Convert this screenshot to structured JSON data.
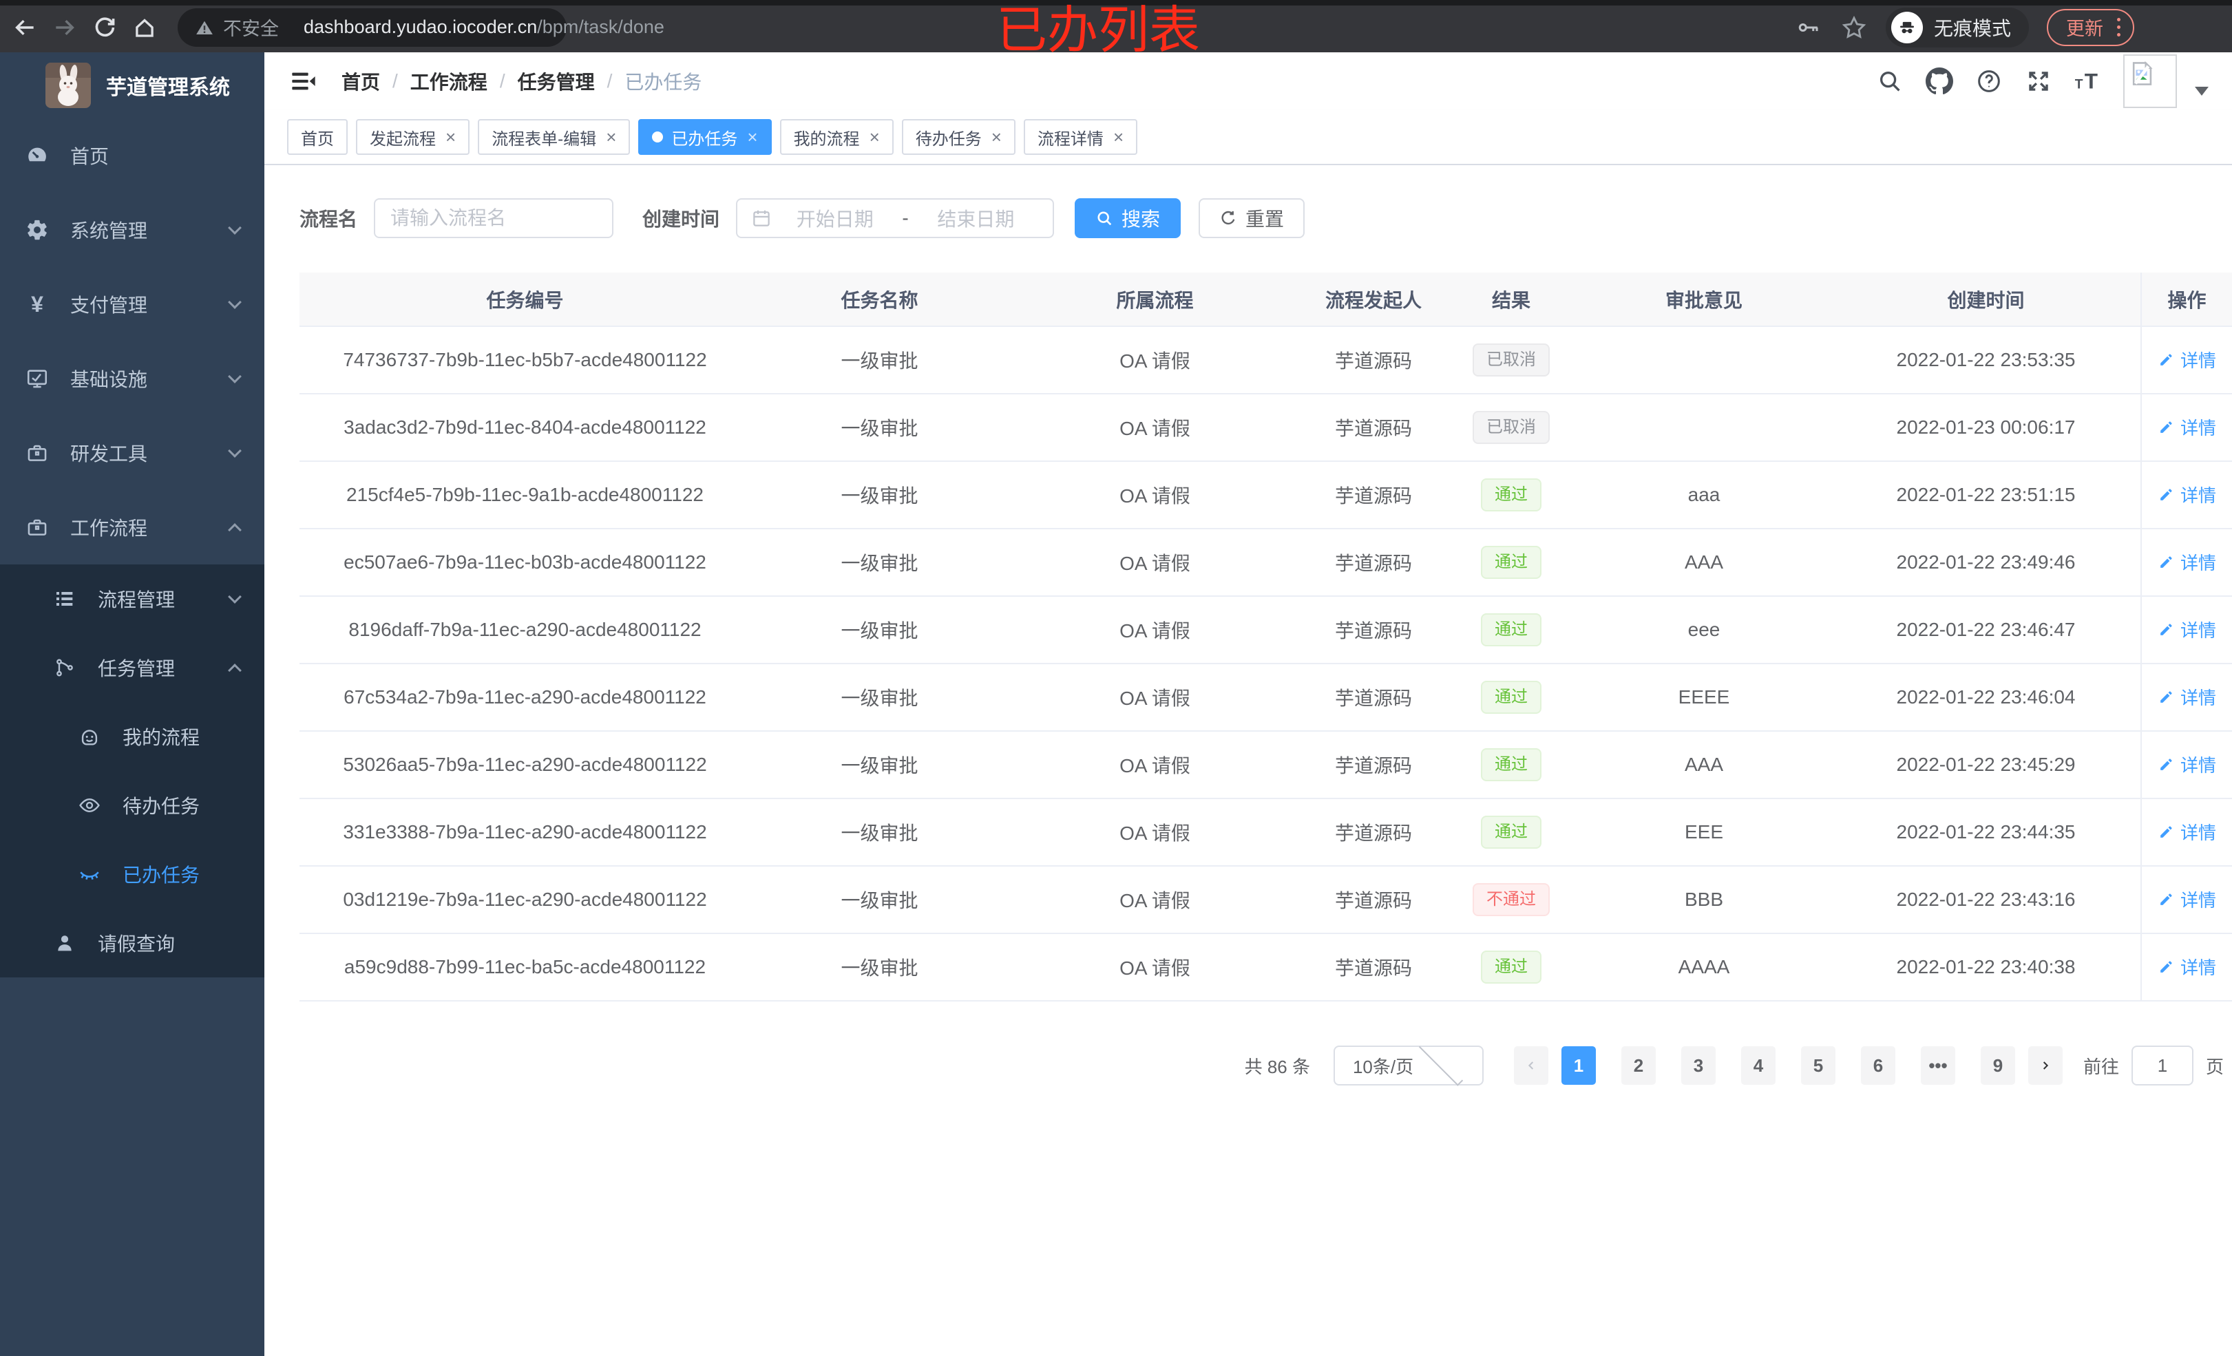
{
  "colors": {
    "accent": "#409eff",
    "success": "#67c23a",
    "danger": "#f56c6c",
    "info": "#909399",
    "sidebar_bg": "#304156",
    "submenu_bg": "#1f2d3d",
    "annotation_red": "#fe2c19",
    "update_chip": "#f28b82"
  },
  "annotation": {
    "text": "已办列表"
  },
  "browser": {
    "security_label": "不安全",
    "url_host": "dashboard.yudao.iocoder.cn",
    "url_path": "/bpm/task/done",
    "incognito_label": "无痕模式",
    "update_label": "更新"
  },
  "sidebar": {
    "title": "芋道管理系统",
    "items": [
      {
        "label": "首页",
        "icon": "dashboard-icon"
      },
      {
        "label": "系统管理",
        "icon": "gear-icon"
      },
      {
        "label": "支付管理",
        "icon": "yen-icon"
      },
      {
        "label": "基础设施",
        "icon": "monitor-icon"
      },
      {
        "label": "研发工具",
        "icon": "toolbox-icon"
      },
      {
        "label": "工作流程",
        "icon": "briefcase-icon",
        "expanded": true
      },
      {
        "label": "流程管理",
        "icon": "list-icon",
        "level": 2
      },
      {
        "label": "任务管理",
        "icon": "branch-icon",
        "level": 2,
        "expanded": true
      },
      {
        "label": "我的流程",
        "icon": "robot-icon",
        "level": 3
      },
      {
        "label": "待办任务",
        "icon": "eye-icon",
        "level": 3
      },
      {
        "label": "已办任务",
        "icon": "eye-closed-icon",
        "level": 3,
        "active": true
      },
      {
        "label": "请假查询",
        "icon": "user-icon",
        "level": 2
      }
    ]
  },
  "breadcrumb": {
    "items": [
      "首页",
      "工作流程",
      "任务管理",
      "已办任务"
    ]
  },
  "tabs": [
    {
      "label": "首页",
      "closable": false,
      "active": false
    },
    {
      "label": "发起流程",
      "closable": true,
      "active": false
    },
    {
      "label": "流程表单-编辑",
      "closable": true,
      "active": false
    },
    {
      "label": "已办任务",
      "closable": true,
      "active": true
    },
    {
      "label": "我的流程",
      "closable": true,
      "active": false
    },
    {
      "label": "待办任务",
      "closable": true,
      "active": false
    },
    {
      "label": "流程详情",
      "closable": true,
      "active": false
    }
  ],
  "filter": {
    "name_label": "流程名",
    "name_placeholder": "请输入流程名",
    "time_label": "创建时间",
    "start_placeholder": "开始日期",
    "range_separator": "-",
    "end_placeholder": "结束日期",
    "search_label": "搜索",
    "reset_label": "重置"
  },
  "table": {
    "columns": [
      "任务编号",
      "任务名称",
      "所属流程",
      "流程发起人",
      "结果",
      "审批意见",
      "创建时间",
      "操作"
    ],
    "action_label": "详情",
    "rows": [
      {
        "id": "74736737-7b9b-11ec-b5b7-acde48001122",
        "name": "一级审批",
        "process": "OA 请假",
        "starter": "芋道源码",
        "result": "已取消",
        "result_type": "info",
        "comment": "",
        "created": "2022-01-22 23:53:35"
      },
      {
        "id": "3adac3d2-7b9d-11ec-8404-acde48001122",
        "name": "一级审批",
        "process": "OA 请假",
        "starter": "芋道源码",
        "result": "已取消",
        "result_type": "info",
        "comment": "",
        "created": "2022-01-23 00:06:17"
      },
      {
        "id": "215cf4e5-7b9b-11ec-9a1b-acde48001122",
        "name": "一级审批",
        "process": "OA 请假",
        "starter": "芋道源码",
        "result": "通过",
        "result_type": "success",
        "comment": "aaa",
        "created": "2022-01-22 23:51:15"
      },
      {
        "id": "ec507ae6-7b9a-11ec-b03b-acde48001122",
        "name": "一级审批",
        "process": "OA 请假",
        "starter": "芋道源码",
        "result": "通过",
        "result_type": "success",
        "comment": "AAA",
        "created": "2022-01-22 23:49:46"
      },
      {
        "id": "8196daff-7b9a-11ec-a290-acde48001122",
        "name": "一级审批",
        "process": "OA 请假",
        "starter": "芋道源码",
        "result": "通过",
        "result_type": "success",
        "comment": "eee",
        "created": "2022-01-22 23:46:47"
      },
      {
        "id": "67c534a2-7b9a-11ec-a290-acde48001122",
        "name": "一级审批",
        "process": "OA 请假",
        "starter": "芋道源码",
        "result": "通过",
        "result_type": "success",
        "comment": "EEEE",
        "created": "2022-01-22 23:46:04"
      },
      {
        "id": "53026aa5-7b9a-11ec-a290-acde48001122",
        "name": "一级审批",
        "process": "OA 请假",
        "starter": "芋道源码",
        "result": "通过",
        "result_type": "success",
        "comment": "AAA",
        "created": "2022-01-22 23:45:29"
      },
      {
        "id": "331e3388-7b9a-11ec-a290-acde48001122",
        "name": "一级审批",
        "process": "OA 请假",
        "starter": "芋道源码",
        "result": "通过",
        "result_type": "success",
        "comment": "EEE",
        "created": "2022-01-22 23:44:35"
      },
      {
        "id": "03d1219e-7b9a-11ec-a290-acde48001122",
        "name": "一级审批",
        "process": "OA 请假",
        "starter": "芋道源码",
        "result": "不通过",
        "result_type": "danger",
        "comment": "BBB",
        "created": "2022-01-22 23:43:16"
      },
      {
        "id": "a59c9d88-7b99-11ec-ba5c-acde48001122",
        "name": "一级审批",
        "process": "OA 请假",
        "starter": "芋道源码",
        "result": "通过",
        "result_type": "success",
        "comment": "AAAA",
        "created": "2022-01-22 23:40:38"
      }
    ]
  },
  "pagination": {
    "total_label": "共 86 条",
    "page_size": "10条/页",
    "pages": [
      {
        "label": "1",
        "active": true
      },
      {
        "label": "2"
      },
      {
        "label": "3"
      },
      {
        "label": "4"
      },
      {
        "label": "5"
      },
      {
        "label": "6"
      },
      {
        "label": "•••"
      },
      {
        "label": "9"
      }
    ],
    "goto_label": "前往",
    "goto_value": "1",
    "page_unit": "页"
  }
}
